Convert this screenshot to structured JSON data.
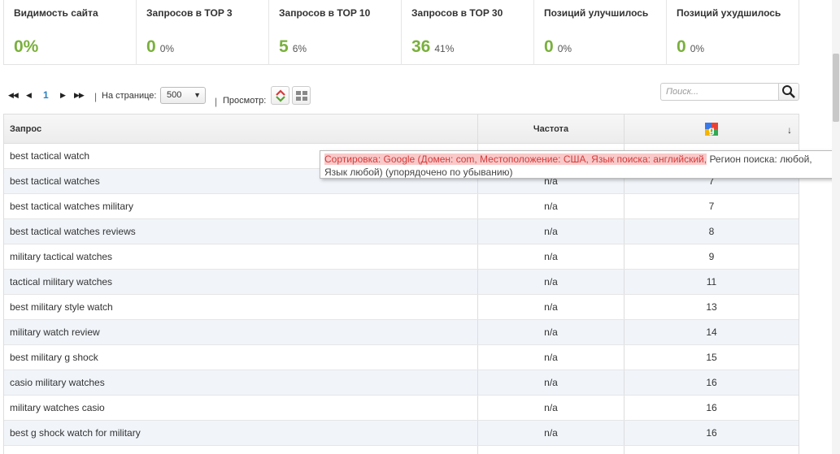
{
  "stats": [
    {
      "title": "Видимость сайта",
      "big": "0%",
      "small": ""
    },
    {
      "title": "Запросов в TOP 3",
      "big": "0",
      "small": "0%"
    },
    {
      "title": "Запросов в TOP 10",
      "big": "5",
      "small": "6%"
    },
    {
      "title": "Запросов в TOP 30",
      "big": "36",
      "small": "41%"
    },
    {
      "title": "Позиций улучшилось",
      "big": "0",
      "small": "0%"
    },
    {
      "title": "Позиций ухудшилось",
      "big": "0",
      "small": "0%"
    }
  ],
  "toolbar": {
    "page": "1",
    "sep": "|",
    "per_page_label": "На странице:",
    "per_page_value": "500",
    "view_label": "Просмотр:",
    "search_placeholder": "Поиск..."
  },
  "table": {
    "headers": {
      "query": "Запрос",
      "frequency": "Частота",
      "sort_arrow": "↓"
    },
    "rows": [
      {
        "query": "best tactical watch",
        "freq": "",
        "pos": ""
      },
      {
        "query": "best tactical watches",
        "freq": "n/a",
        "pos": "7"
      },
      {
        "query": "best tactical watches military",
        "freq": "n/a",
        "pos": "7"
      },
      {
        "query": "best tactical watches reviews",
        "freq": "n/a",
        "pos": "8"
      },
      {
        "query": "military tactical watches",
        "freq": "n/a",
        "pos": "9"
      },
      {
        "query": "tactical military watches",
        "freq": "n/a",
        "pos": "11"
      },
      {
        "query": "best military style watch",
        "freq": "n/a",
        "pos": "13"
      },
      {
        "query": "military watch review",
        "freq": "n/a",
        "pos": "14"
      },
      {
        "query": "best military g shock",
        "freq": "n/a",
        "pos": "15"
      },
      {
        "query": "casio military watches",
        "freq": "n/a",
        "pos": "16"
      },
      {
        "query": "military watches casio",
        "freq": "n/a",
        "pos": "16"
      },
      {
        "query": "best g shock watch for military",
        "freq": "n/a",
        "pos": "16"
      },
      {
        "query": "",
        "freq": "",
        "pos": ""
      }
    ]
  },
  "tooltip": {
    "highlight": "Сортировка: Google (Домен: com, Местоположение: США, Язык поиска: английский,",
    "rest": " Регион поиска: любой, Язык любой) (упорядочено по убыванию)"
  },
  "colors": {
    "accent_green": "#7ab03c",
    "link_blue": "#2a7fc1",
    "tooltip_highlight": "#f9c9c9"
  }
}
